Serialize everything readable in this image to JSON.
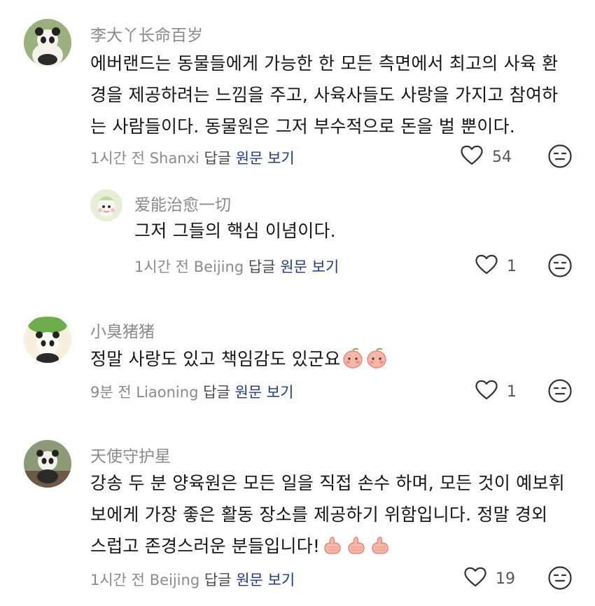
{
  "comments": [
    {
      "username": "李大丫长命百岁",
      "lines": [
        "에버랜드는 동물들에게 가능한 한 모든 측면에서 최고의 사육 환",
        "경을 제공하려는 느낌을 주고, 사육사들도 사랑을 가지고 참여하",
        "는 사람들이다. 동물원은 그저 부수적으로 돈을 벌 뿐이다."
      ],
      "time": "1시간 전",
      "location": "Shanxi",
      "reply_label": "답글",
      "original_label": "원문 보기",
      "likes": "54"
    },
    {
      "username": "爱能治愈一切",
      "lines": [
        "그저 그들의 핵심 이념이다."
      ],
      "time": "1시간 전",
      "location": "Beijing",
      "reply_label": "답글",
      "original_label": "원문 보기",
      "likes": "1"
    },
    {
      "username": "小臭猪猪",
      "lines": [
        "정말 사랑도 있고 책임감도 있군요"
      ],
      "time": "9분 전",
      "location": "Liaoning",
      "reply_label": "답글",
      "original_label": "원문 보기",
      "likes": "1"
    },
    {
      "username": "天使守护星",
      "lines": [
        "강송 두 분 양육원은 모든 일을 직접 손수 하며, 모든 것이 예보휘",
        "보에게 가장 좋은 활동 장소를 제공하기 위함입니다. 정말 경외",
        "스럽고 존경스러운 분들입니다!"
      ],
      "time": "1시간 전",
      "location": "Beijing",
      "reply_label": "답글",
      "original_label": "원문 보기",
      "likes": "19"
    }
  ],
  "icons": {
    "like": "heart-outline-icon",
    "reaction": "neutral-face-icon",
    "emoji_shy": "shy-peach-emoji",
    "emoji_thumb": "thumbs-up-emoji"
  },
  "colors": {
    "username": "#8a8a8a",
    "meta": "#8a8a8a",
    "original_link": "#1f3a8a"
  }
}
